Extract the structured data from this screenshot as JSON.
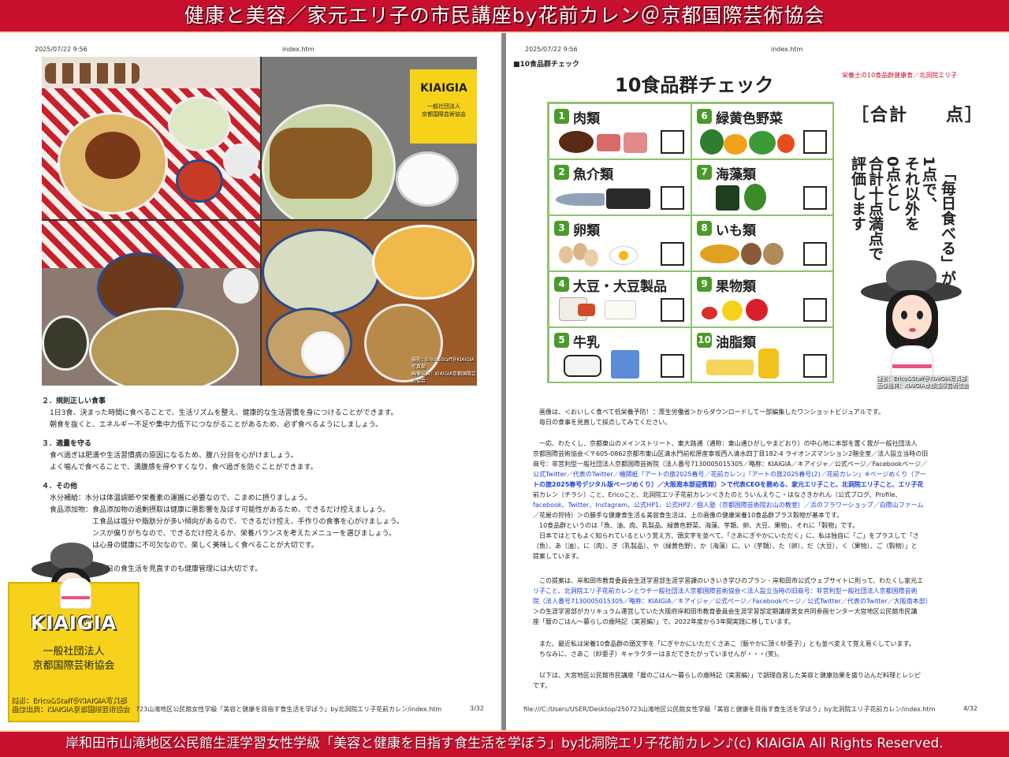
{
  "banner_top": "健康と美容／家元エリ子の市民講座by花前カレン＠京都国際芸術協会",
  "banner_bottom": "岸和田市山滝地区公民館生涯学習女性学級「美容と健康を目指す食生活を学ぼう」by北洞院エリ子花前カレン♪(c) KIAIGIA All Rights Reserved.",
  "left_page": {
    "header_datetime": "2025/07/22 9:56",
    "header_file": "index.htm",
    "photo_badge": {
      "name": "KIAIGIA",
      "line1": "一般社団法人",
      "line2": "京都国際芸術協会"
    },
    "photo_credit_1": "撮影：Erico&Staff＠KIAIGIA写真部",
    "photo_credit_2": "画像出典：KIAIGIA京都国際芸術協会",
    "sections": [
      {
        "title": "２．規則正しい食事",
        "lines": [
          "1日3食、決まった時間に食べることで、生活リズムを整え、健康的な生活習慣を身につけることができます。",
          "朝食を抜くと、エネルギー不足や集中力低下につながることがあるため、必ず食べるようにしましょう。"
        ]
      },
      {
        "title": "３．適量を守る",
        "lines": [
          "食べ過ぎは肥満や生活習慣病の原因になるため、腹八分目を心がけましょう。",
          "よく噛んで食べることで、満腹感を得やすくなり、食べ過ぎを防ぐことができます。"
        ]
      },
      {
        "title": "４．その他",
        "lines": [
          "水分補給：水分は体温調節や栄養素の運搬に必要なので、こまめに摂りましょう。",
          "食品添加物：食品添加物の過剰摂取は健康に悪影響を及ぼす可能性があるため、できるだけ控えましょう。",
          "　　　　　　工食品は塩分や脂肪分が多い傾向があるので、できるだけ控え、手作りの食事を心がけましょう。",
          "　　　　　　ンスが偏りがちなので、できるだけ控えるか、栄養バランスを考えたメニューを選びましょう。",
          "　　　　　　は心身の健康に不可欠なので、楽しく美味しく食べることが大切です。",
          "",
          "　　　　　　、毎日の食生活を見直すのも健康管理には大切です。"
        ]
      }
    ],
    "kiaigia_box": {
      "name": "KIAIGIA",
      "line1": "一般社団法人",
      "line2": "京都国際芸術協会"
    },
    "box_credit_1": "撮影：Erico&Staff＠KIAIGIA写真部",
    "box_credit_2": "画像出典：KIAIGIA京都国際芸術協会",
    "footer_path": "723山滝地区公民館女性学級「美容と健康を目指す食生活を学ぼう」by北洞院エリ子花前カレン/index.htm",
    "footer_page": "3/32"
  },
  "right_page": {
    "header_datetime": "2025/07/22 9:56",
    "header_file": "index.htm",
    "section_label": "■10食品群チェック",
    "chart_title": "10食品群チェック",
    "chart_source": "栄養士の10食品群健康食／北洞院エリ子",
    "food_groups": [
      {
        "num": "1",
        "name": "肉類"
      },
      {
        "num": "6",
        "name": "緑黄色野菜"
      },
      {
        "num": "2",
        "name": "魚介類"
      },
      {
        "num": "7",
        "name": "海藻類"
      },
      {
        "num": "3",
        "name": "卵類"
      },
      {
        "num": "8",
        "name": "いも類"
      },
      {
        "num": "4",
        "name": "大豆・大豆製品"
      },
      {
        "num": "9",
        "name": "果物類"
      },
      {
        "num": "5",
        "name": "牛乳"
      },
      {
        "num": "10",
        "name": "油脂類"
      }
    ],
    "score_label": "［合計　　点］",
    "vertical_text": [
      "「毎日食べる」が",
      "1点で、",
      "それ以外を",
      "0点とし",
      "合計十点満点で",
      "評価します"
    ],
    "credit_1": "撮影：Erico&Staff＠KIAIGIA写真部",
    "credit_2": "画像出典：KIAIGIA京都国際芸術協会",
    "p1": "画像は、＜おいしく食べて低栄養予防！：厚生労働省＞からダウンロードして一部編集したワンショットビジュアルです。",
    "p1b": "毎日の食事を見直して採点してみてください。",
    "p2": [
      "一応、わたくし、京都東山のメインストリート、東大路通（通称：東山通ひがしやまどおり）の中心地に本部を置く我が一般社団法人",
      "京都国際芸術協会＜〒605-0862京都市東山区清水門前松原産寧坂西入清水四丁目182-4 ライオンズマンション2階全室／法人設立当時の旧",
      "商号：非営利型一般社団法人京都国際芸術院（法人番号7130005015305／略称：KIAIGIA／キアイジャ／公式ページ／Facebookページ／",
      "公式Twitter／代表のTwitter／機関紙『アートの旅2025春号／花前カレン』『アートの旅2025春号(2)／花前カレン』※ページめくり（アー",
      "トの旅2025春号デジタル版ページめくり）／大阪南本部迎賓館）＞で代表CEOを務める、家元エリ子こと、北洞院エリ子こと、エリ子花",
      "前カレン（チラシ）こと、Ericoこと、北洞院エリ子花前カレン＜きたのとういんえりこ・はなさきかれん（公式ブログ、Profile、",
      "facebook、Twitter、Instagram、公式HP1、公式HP2／個人塾（京都国際芸術院お山の教室）／浜のフラワーショップ／白際山ファーム",
      "／花屋の狩持）＞の勝手な健康食生活＆美容食生活は、上の画像の健康栄養10食品群プラス穀物が基本です。",
      "　10食品群というのは「魚、油、肉、乳製品、緑黄色野菜、海藻、芋類、卵、大豆、果物」、それに「穀物」です。",
      "　日本ではとてもよく知られているという覚え方、頭文字を並べて、「さあにぎやかにいただく」に、私は独自に「ご」をプラスして「さ",
      "（魚）、あ（油）、に（肉）、ぎ（乳製品）、や（緑黄色野）、か（海藻）に、い（芋類）、た（卵）、だ（大豆）、く（果物）、ご（穀物）」と",
      "提案しています。"
    ],
    "p3": [
      "　この提案は、岸和田市教育委員会生涯学習部生涯学習課のいきいき学びのプラン - 岸和田市公式ウェブサイトに則って、わたくし家元エ",
      "リ子こと、北洞院エリ子花前カレンとウチ一般社団法人京都国際芸術協会＜法人設立当時の旧商号：非営利型一般社団法人京都国際芸術",
      "院（法人番号7130005015305／略称：KIAIGIA／キアイジャ／公式ページ／Facebookページ／公式Twitter／代表のTwitter／大阪南本部）",
      "＞の生涯学習部がカリキュラム運営していた大阪府岸和田市教育委員会生涯学習部定期講座男女共同参画センター大宮地区公民館市民講",
      "座「暦のごはん～暮らしの歳時記（実習編）」で、2022年度から3年間実践に移しています。"
    ],
    "p4": [
      "　また、最近私は栄養10食品群の頭文字を「にぎやかにいただくさあこ（賑やかに頂く紗亜子）」とも並べ変えて覚え易くしています。",
      "　ちなみに、さあこ（紗亜子）キャラクターはまだできたがっていませんが・・・(笑)。"
    ],
    "p5": "　以下は、大宮地区公民館市民講座「暦のごはん～暮らしの歳時記（実習編）」で調理自習した美容と健康効果を盛り込んだ料理とレシピ",
    "p5b": "です。",
    "footer_path": "file:///C:/Users/USER/Desktop/250723山滝地区公民館女性学級「美容と健康を目指す食生活を学ぼう」by北洞院エリ子花前カレン/index.htm",
    "footer_page": "4/32"
  }
}
